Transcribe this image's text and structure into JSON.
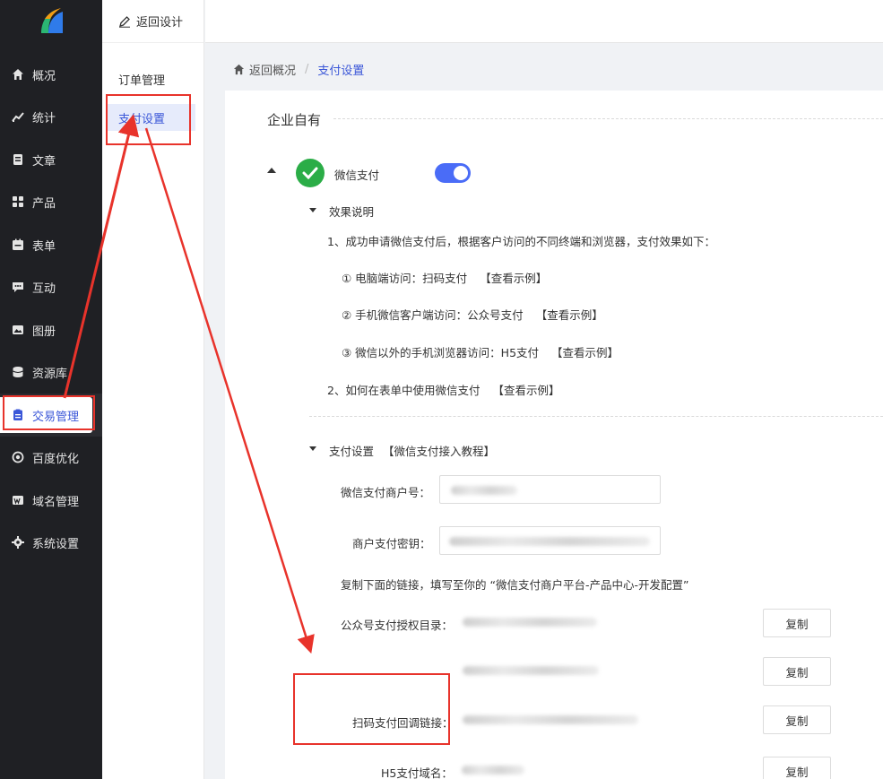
{
  "sidebar": {
    "items": [
      {
        "label": "概况",
        "icon": "home-icon"
      },
      {
        "label": "统计",
        "icon": "stats-icon"
      },
      {
        "label": "文章",
        "icon": "article-icon"
      },
      {
        "label": "产品",
        "icon": "product-icon"
      },
      {
        "label": "表单",
        "icon": "form-icon"
      },
      {
        "label": "互动",
        "icon": "chat-icon"
      },
      {
        "label": "图册",
        "icon": "album-icon"
      },
      {
        "label": "资源库",
        "icon": "database-icon"
      },
      {
        "label": "交易管理",
        "icon": "trade-icon"
      },
      {
        "label": "百度优化",
        "icon": "seo-icon"
      },
      {
        "label": "域名管理",
        "icon": "domain-icon"
      },
      {
        "label": "系统设置",
        "icon": "gear-icon"
      }
    ],
    "active_index": 8
  },
  "subbar": {
    "back_label": "返回设计",
    "items": [
      {
        "label": "订单管理"
      },
      {
        "label": "支付设置"
      }
    ],
    "active_index": 1
  },
  "breadcrumb": {
    "home": "返回概况",
    "sep": "/",
    "current": "支付设置"
  },
  "main": {
    "section_title": "企业自有",
    "wechat_label": "微信支付",
    "wechat_enabled": true,
    "effect": {
      "title": "效果说明",
      "line1": "1、成功申请微信支付后，根据客户访问的不同终端和浏览器，支付效果如下：",
      "items": [
        {
          "text": "① 电脑端访问：扫码支付",
          "link": "【查看示例】"
        },
        {
          "text": "② 手机微信客户端访问：公众号支付",
          "link": "【查看示例】"
        },
        {
          "text": "③ 微信以外的手机浏览器访问：H5支付",
          "link": "【查看示例】"
        }
      ],
      "line2": "2、如何在表单中使用微信支付",
      "line2_link": "【查看示例】"
    },
    "pay": {
      "title": "支付设置",
      "tutorial_link": "【微信支付接入教程】",
      "merchant_id_label": "微信支付商户号：",
      "merchant_key_label": "商户支付密钥：",
      "copy_hint": "复制下面的链接，填写至你的 “微信支付商户平台-产品中心-开发配置”",
      "rows": [
        {
          "label": "公众号支付授权目录：",
          "button": "复制"
        },
        {
          "label": "",
          "button": "复制"
        },
        {
          "label": "扫码支付回调链接：",
          "button": "复制"
        },
        {
          "label": "H5支付域名：",
          "button": "复制"
        }
      ]
    }
  },
  "colors": {
    "accent": "#3b57d8",
    "toggle": "#4a6cf7",
    "annotation": "#e8332b",
    "sidebar_bg": "#1f2024"
  }
}
